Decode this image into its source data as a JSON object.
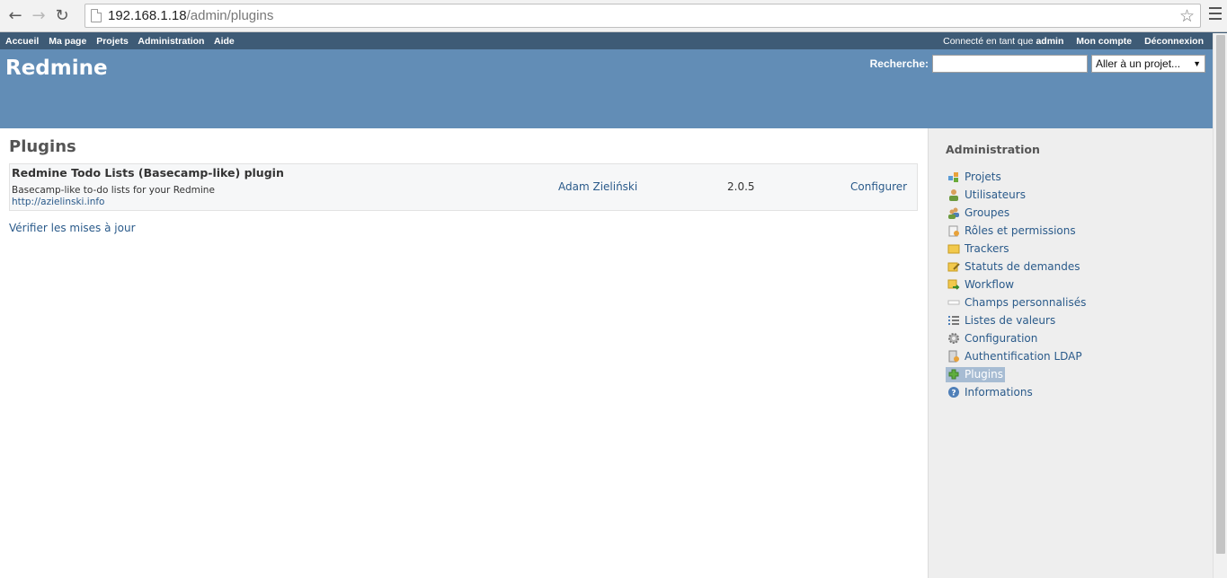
{
  "browser": {
    "url_host": "192.168.1.18",
    "url_path": "/admin/plugins"
  },
  "topmenu": {
    "items": [
      "Accueil",
      "Ma page",
      "Projets",
      "Administration",
      "Aide"
    ],
    "logged_as_prefix": "Connecté en tant que ",
    "logged_user": "admin",
    "account": "Mon compte",
    "logout": "Déconnexion"
  },
  "header": {
    "title": "Redmine",
    "search_label": "Recherche:",
    "search_value": "",
    "jump_label": "Aller à un projet..."
  },
  "content": {
    "title": "Plugins",
    "plugin": {
      "name": "Redmine Todo Lists (Basecamp-like) plugin",
      "description": "Basecamp-like to-do lists for your Redmine",
      "url": "http://azielinski.info",
      "author": "Adam Zieliński",
      "version": "2.0.5",
      "configure": "Configurer"
    },
    "check_updates": "Vérifier les mises à jour"
  },
  "sidebar": {
    "title": "Administration",
    "items": [
      {
        "label": "Projets",
        "icon": "projects-icon"
      },
      {
        "label": "Utilisateurs",
        "icon": "user-icon"
      },
      {
        "label": "Groupes",
        "icon": "group-icon"
      },
      {
        "label": "Rôles et permissions",
        "icon": "roles-icon"
      },
      {
        "label": "Trackers",
        "icon": "tracker-icon"
      },
      {
        "label": "Statuts de demandes",
        "icon": "issue-status-icon"
      },
      {
        "label": "Workflow",
        "icon": "workflow-icon"
      },
      {
        "label": "Champs personnalisés",
        "icon": "custom-fields-icon"
      },
      {
        "label": "Listes de valeurs",
        "icon": "list-icon"
      },
      {
        "label": "Configuration",
        "icon": "gear-icon"
      },
      {
        "label": "Authentification LDAP",
        "icon": "server-key-icon"
      },
      {
        "label": "Plugins",
        "icon": "plugin-icon"
      },
      {
        "label": "Informations",
        "icon": "help-icon"
      }
    ],
    "selected": "Plugins"
  },
  "colors": {
    "topmenu_bg": "#3e5b76",
    "header_bg": "#628db6",
    "link": "#2a5a8a",
    "sidebar_bg": "#eeeeee",
    "selected_bg": "#a7bcd3"
  }
}
